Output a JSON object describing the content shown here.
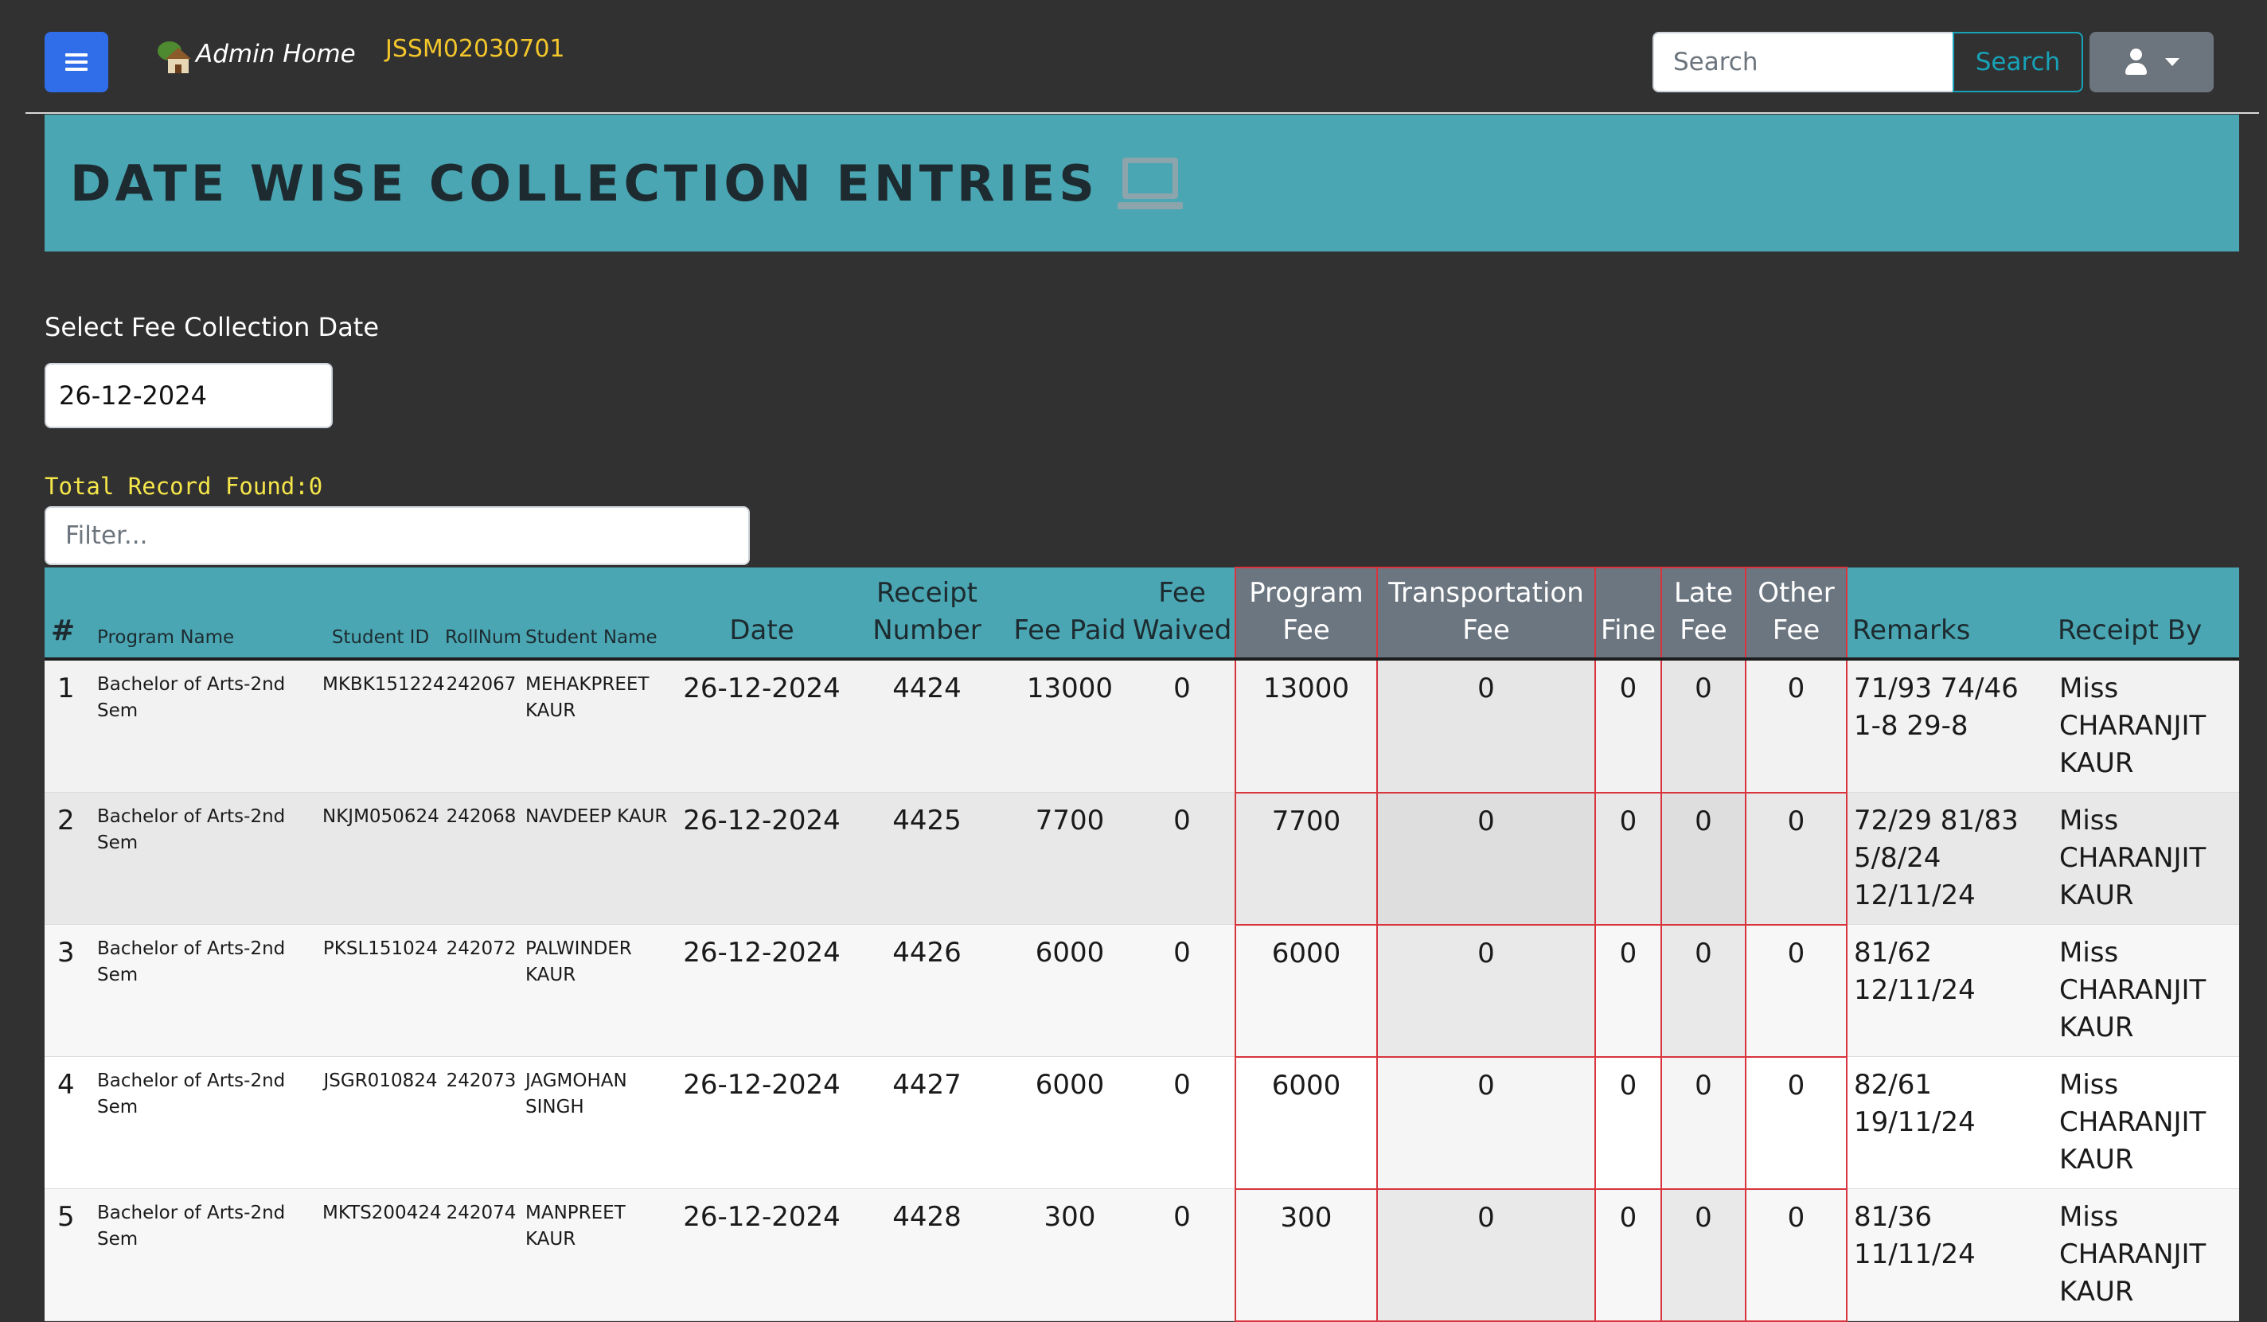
{
  "navbar": {
    "home_label": "Admin Home",
    "code": "JSSM02030701",
    "search_placeholder": "Search",
    "search_button": "Search"
  },
  "page": {
    "title": "DATE WISE COLLECTION ENTRIES",
    "date_label": "Select Fee Collection Date",
    "date_value": "26-12-2024",
    "records_text": "Total Record Found:0",
    "filter_placeholder": "Filter..."
  },
  "table": {
    "headers": {
      "num": "#",
      "program": "Program Name",
      "student_id": "Student ID",
      "roll": "RollNum",
      "student_name": "Student Name",
      "date": "Date",
      "receipt": "Receipt Number",
      "fee_paid": "Fee Paid",
      "fee_waived": "Fee Waived",
      "program_fee": "Program Fee",
      "transport_fee": "Transportation Fee",
      "fine": "Fine",
      "late_fee": "Late Fee",
      "other_fee": "Other Fee",
      "remarks": "Remarks",
      "receipt_by": "Receipt By"
    },
    "rows": [
      {
        "num": "1",
        "program": "Bachelor of Arts-2nd Sem",
        "student_id": "MKBK151224",
        "roll": "242067",
        "student_name": "MEHAKPREET KAUR",
        "date": "26-12-2024",
        "receipt": "4424",
        "fee_paid": "13000",
        "fee_waived": "0",
        "program_fee": "13000",
        "transport_fee": "0",
        "fine": "0",
        "late_fee": "0",
        "other_fee": "0",
        "remarks": "71/93 74/46 1-8 29-8",
        "receipt_by": "Miss CHARANJIT KAUR"
      },
      {
        "num": "2",
        "program": "Bachelor of Arts-2nd Sem",
        "student_id": "NKJM050624",
        "roll": "242068",
        "student_name": "NAVDEEP KAUR",
        "date": "26-12-2024",
        "receipt": "4425",
        "fee_paid": "7700",
        "fee_waived": "0",
        "program_fee": "7700",
        "transport_fee": "0",
        "fine": "0",
        "late_fee": "0",
        "other_fee": "0",
        "remarks": "72/29 81/83 5/8/24 12/11/24",
        "receipt_by": "Miss CHARANJIT KAUR"
      },
      {
        "num": "3",
        "program": "Bachelor of Arts-2nd Sem",
        "student_id": "PKSL151024",
        "roll": "242072",
        "student_name": "PALWINDER KAUR",
        "date": "26-12-2024",
        "receipt": "4426",
        "fee_paid": "6000",
        "fee_waived": "0",
        "program_fee": "6000",
        "transport_fee": "0",
        "fine": "0",
        "late_fee": "0",
        "other_fee": "0",
        "remarks": "81/62 12/11/24",
        "receipt_by": "Miss CHARANJIT KAUR"
      },
      {
        "num": "4",
        "program": "Bachelor of Arts-2nd Sem",
        "student_id": "JSGR010824",
        "roll": "242073",
        "student_name": "JAGMOHAN SINGH",
        "date": "26-12-2024",
        "receipt": "4427",
        "fee_paid": "6000",
        "fee_waived": "0",
        "program_fee": "6000",
        "transport_fee": "0",
        "fine": "0",
        "late_fee": "0",
        "other_fee": "0",
        "remarks": "82/61 19/11/24",
        "receipt_by": "Miss CHARANJIT KAUR"
      },
      {
        "num": "5",
        "program": "Bachelor of Arts-2nd Sem",
        "student_id": "MKTS200424",
        "roll": "242074",
        "student_name": "MANPREET KAUR",
        "date": "26-12-2024",
        "receipt": "4428",
        "fee_paid": "300",
        "fee_waived": "0",
        "program_fee": "300",
        "transport_fee": "0",
        "fine": "0",
        "late_fee": "0",
        "other_fee": "0",
        "remarks": "81/36 11/11/24",
        "receipt_by": "Miss CHARANJIT KAUR"
      }
    ]
  },
  "colors": {
    "background": "#313131",
    "accent": "#4aa6b3",
    "primary_button": "#2f6ee8",
    "code_text": "#f3c62b",
    "records_text": "#f5e64a",
    "highlight_border": "#d9343d",
    "highlight_header": "#6c7680"
  },
  "icons": {
    "menu": "hamburger-icon",
    "home": "house-icon",
    "title": "laptop-icon",
    "user": "user-icon",
    "dropdown": "caret-down-icon"
  }
}
